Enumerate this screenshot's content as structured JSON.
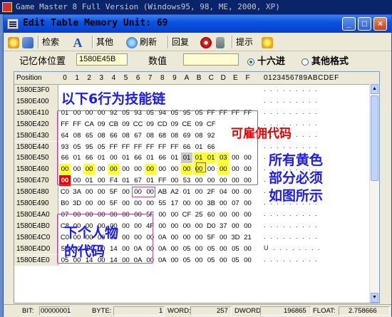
{
  "outer_title": "Game Master 8 Full Version (Windows95, 98, ME, 2000, XP)",
  "window": {
    "title": "Edit Table  Memory Unit: 69",
    "min_label": "_",
    "max_label": "□",
    "close_label": "×"
  },
  "toolbar": {
    "search_label": "检索",
    "other_label": "其他",
    "refresh_label": "刷新",
    "back_label": "回复",
    "hint_label": "提示"
  },
  "address_bar": {
    "addr_label": "记忆体位置",
    "addr_value": "1580E45B",
    "value_label": "数值",
    "value_value": "",
    "hex_label": "十六进",
    "other_format_label": "其他格式"
  },
  "grid": {
    "position_header": "Position",
    "hex_columns": [
      "0",
      "1",
      "2",
      "3",
      "4",
      "5",
      "6",
      "7",
      "8",
      "9",
      "A",
      "B",
      "C",
      "D",
      "E",
      "F"
    ],
    "ascii_header": "0123456789ABCDEF",
    "rows": [
      {
        "addr": "1580E3F0",
        "cells": [
          "",
          "",
          "",
          "",
          "",
          "",
          "",
          "",
          "",
          "",
          "",
          "",
          "",
          "",
          "",
          ""
        ],
        "ascii": ". . . . . . . . ."
      },
      {
        "addr": "1580E400",
        "cells": [
          "",
          "",
          "",
          "",
          "",
          "",
          "",
          "",
          "",
          "",
          "",
          "",
          "",
          "",
          "",
          ""
        ],
        "ascii": ". . . . . . . . ."
      },
      {
        "addr": "1580E410",
        "cells": [
          "01",
          "00",
          "00",
          "00",
          "92",
          "05",
          "93",
          "05",
          "94",
          "05",
          "95",
          "05",
          "FF",
          "FF",
          "FF",
          "FF"
        ],
        "ascii": ". . . . . . . . ."
      },
      {
        "addr": "1580E420",
        "cells": [
          "FF",
          "FF",
          "CA",
          "09",
          "CB",
          "09",
          "CC",
          "09",
          "CD",
          "09",
          "CE",
          "09",
          "CF",
          "",
          "",
          ""
        ],
        "ascii": ". . . . . . . . ."
      },
      {
        "addr": "1580E430",
        "cells": [
          "64",
          "08",
          "65",
          "08",
          "66",
          "08",
          "67",
          "08",
          "68",
          "08",
          "69",
          "08",
          "92",
          "",
          "",
          ""
        ],
        "ascii": ". . . . . . . . ."
      },
      {
        "addr": "1580E440",
        "cells": [
          "93",
          "05",
          "95",
          "05",
          "FF",
          "FF",
          "FF",
          "FF",
          "FF",
          "FF",
          "66",
          "01",
          "66",
          "",
          "",
          ""
        ],
        "ascii": ". . . . . . . . ."
      },
      {
        "addr": "1580E450",
        "cells": [
          "66",
          "01",
          "66",
          "01",
          "00",
          "01",
          "66",
          "01",
          "66",
          "01",
          "01",
          "01",
          "01",
          "03",
          "00",
          "00"
        ],
        "ascii": ". . . . . . . . ."
      },
      {
        "addr": "1580E460",
        "cells": [
          "00",
          "00",
          "00",
          "00",
          "00",
          "00",
          "00",
          "00",
          "00",
          "00",
          "00",
          "00",
          "00",
          "00",
          "00",
          "00"
        ],
        "ascii": ". . . . . . . . ."
      },
      {
        "addr": "1580E470",
        "cells": [
          "00",
          "00",
          "01",
          "00",
          "F4",
          "01",
          "67",
          "01",
          "FF",
          "00",
          "53",
          "00",
          "00",
          "00",
          "00",
          "00"
        ],
        "ascii": ". . . . . . . . ."
      },
      {
        "addr": "1580E480",
        "cells": [
          "C0",
          "3A",
          "00",
          "00",
          "5F",
          "00",
          "00",
          "00",
          "AB",
          "A2",
          "01",
          "00",
          "2F",
          "04",
          "00",
          "00"
        ],
        "ascii": ". . . . . . . . ."
      },
      {
        "addr": "1580E490",
        "cells": [
          "B0",
          "3D",
          "00",
          "00",
          "5F",
          "00",
          "00",
          "00",
          "55",
          "17",
          "00",
          "00",
          "3B",
          "00",
          "07",
          "00"
        ],
        "ascii": ". . . . . . . . ."
      },
      {
        "addr": "1580E4A0",
        "cells": [
          "07",
          "00",
          "00",
          "00",
          "00",
          "00",
          "00",
          "5F",
          "00",
          "00",
          "CF",
          "25",
          "60",
          "00",
          "00",
          "00"
        ],
        "ascii": ". . . . . . . . ."
      },
      {
        "addr": "1580E4B0",
        "cells": [
          "C8",
          "00",
          "00",
          "00",
          "00",
          "00",
          "00",
          "4F",
          "00",
          "00",
          "00",
          "00",
          "D0",
          "37",
          "00",
          "00"
        ],
        "ascii": ". . . . . . . . ."
      },
      {
        "addr": "1580E4C0",
        "cells": [
          "C0",
          "00",
          "00",
          "00",
          "00",
          "00",
          "00",
          "00",
          "0A",
          "00",
          "00",
          "00",
          "5F",
          "00",
          "3D",
          "21"
        ],
        "ascii": ". . . . . . . . ."
      },
      {
        "addr": "1580E4D0",
        "cells": [
          "55",
          "00",
          "14",
          "00",
          "14",
          "00",
          "0A",
          "00",
          "0A",
          "00",
          "05",
          "00",
          "05",
          "00",
          "05",
          "00"
        ],
        "ascii": "U . . . . . . . ."
      },
      {
        "addr": "1580E4E0",
        "cells": [
          "05",
          "00",
          "14",
          "00",
          "14",
          "00",
          "0A",
          "00",
          "0A",
          "00",
          "05",
          "00",
          "05",
          "00",
          "05",
          "00"
        ],
        "ascii": ". . . . . . . . ."
      }
    ]
  },
  "status": {
    "bit_label": "BIT:",
    "bit_value": "00000001",
    "byte_label": "BYTE:",
    "byte_value": "1",
    "word_label": "WORD:",
    "word_value": "257",
    "dword_label": "DWORD:",
    "dword_value": "196865",
    "float_label": "FLOAT:",
    "float_value": "2.758666"
  },
  "annotations": {
    "skill_chain": "以下6行为技能链",
    "hireable": "可雇佣代码",
    "yellow_note_1": "所有黄色",
    "yellow_note_2": "部分必须",
    "yellow_note_3": "如图所示",
    "next_char_1": "下个人物",
    "next_char_2": "的代码"
  },
  "colors": {
    "highlight_yellow": "#ffff33",
    "highlight_red": "#e00000",
    "annotation_blue": "#1a1aff",
    "frame_magenta": "#c04aa8",
    "titlebar_blue": "#0a54e0"
  }
}
